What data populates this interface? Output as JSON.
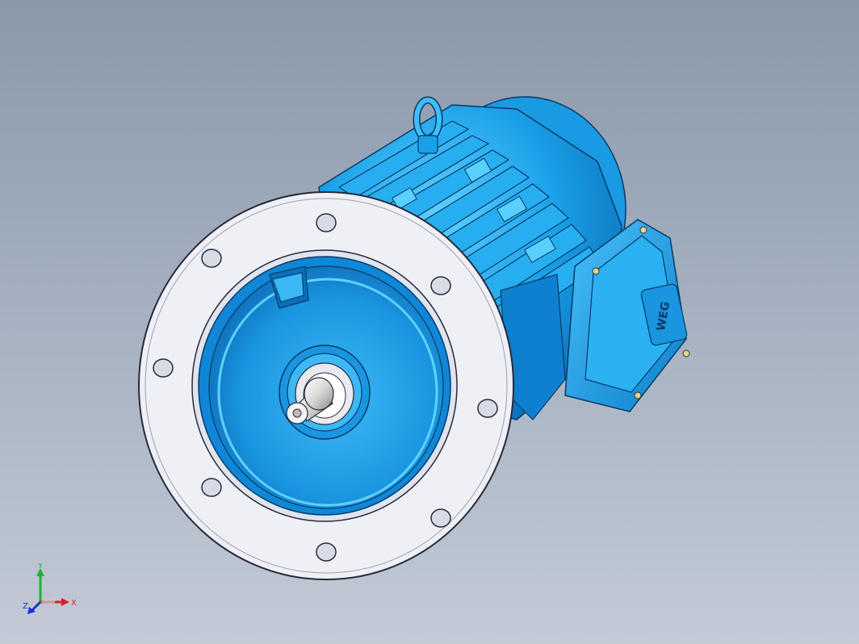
{
  "viewport": {
    "background_top": "#8a98aa",
    "background_bottom": "#c2cad6"
  },
  "model": {
    "body_color": "#1aa0e8",
    "body_dark": "#0b6fb8",
    "flange_color": "#eef0f6",
    "nameplate_text": "WEG"
  },
  "triad": {
    "x_label": "X",
    "y_label": "Y",
    "z_label": "Z",
    "x_color": "#e02020",
    "y_color": "#20b030",
    "z_color": "#2030d0"
  }
}
